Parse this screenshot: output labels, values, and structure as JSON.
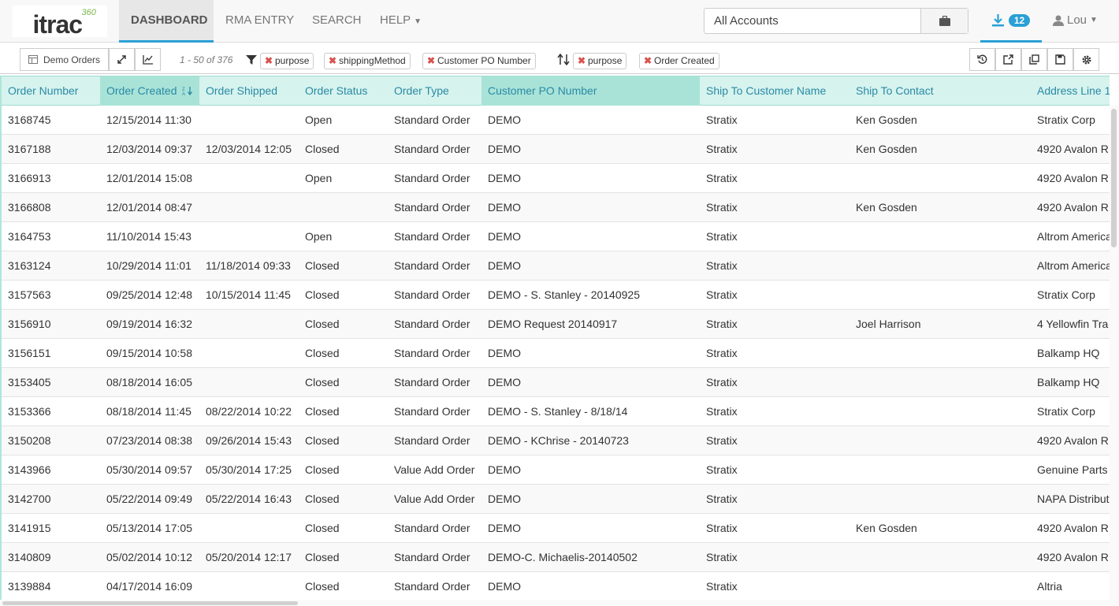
{
  "app": {
    "logo_text": "itrac",
    "logo_suffix": "360"
  },
  "nav": {
    "dashboard": "DASHBOARD",
    "rma": "RMA ENTRY",
    "search": "SEARCH",
    "help": "HELP"
  },
  "accounts": {
    "value": "All Accounts"
  },
  "downloads": {
    "count": "12"
  },
  "user": {
    "name": "Lou"
  },
  "toolbar": {
    "view_label": "Demo Orders",
    "count_text": "1 - 50 of 376",
    "filters": [
      "purpose",
      "shippingMethod",
      "Customer PO Number"
    ],
    "sorts": [
      "purpose",
      "Order Created"
    ]
  },
  "table": {
    "columns": [
      "Order Number",
      "Order Created",
      "Order Shipped",
      "Order Status",
      "Order Type",
      "Customer PO Number",
      "Ship To Customer Name",
      "Ship To Contact",
      "Address Line 1"
    ],
    "rows": [
      [
        "3168745",
        "12/15/2014 11:30",
        "",
        "Open",
        "Standard Order",
        "DEMO",
        "Stratix",
        "Ken Gosden",
        "Stratix Corp"
      ],
      [
        "3167188",
        "12/03/2014 09:37",
        "12/03/2014 12:05",
        "Closed",
        "Standard Order",
        "DEMO",
        "Stratix",
        "Ken Gosden",
        "4920 Avalon R"
      ],
      [
        "3166913",
        "12/01/2014 15:08",
        "",
        "Open",
        "Standard Order",
        "DEMO",
        "Stratix",
        "",
        "4920 Avalon R"
      ],
      [
        "3166808",
        "12/01/2014 08:47",
        "",
        "",
        "Standard Order",
        "DEMO",
        "Stratix",
        "Ken Gosden",
        "4920 Avalon R"
      ],
      [
        "3164753",
        "11/10/2014 15:43",
        "",
        "Open",
        "Standard Order",
        "DEMO",
        "Stratix",
        "",
        "Altrom America"
      ],
      [
        "3163124",
        "10/29/2014 11:01",
        "11/18/2014 09:33",
        "Closed",
        "Standard Order",
        "DEMO",
        "Stratix",
        "",
        "Altrom America"
      ],
      [
        "3157563",
        "09/25/2014 12:48",
        "10/15/2014 11:45",
        "Closed",
        "Standard Order",
        "DEMO - S. Stanley - 20140925",
        "Stratix",
        "",
        "Stratix Corp"
      ],
      [
        "3156910",
        "09/19/2014 16:32",
        "",
        "Closed",
        "Standard Order",
        "DEMO Request 20140917",
        "Stratix",
        "Joel Harrison",
        "4 Yellowfin Tra"
      ],
      [
        "3156151",
        "09/15/2014 10:58",
        "",
        "Closed",
        "Standard Order",
        "DEMO",
        "Stratix",
        "",
        "Balkamp HQ"
      ],
      [
        "3153405",
        "08/18/2014 16:05",
        "",
        "Closed",
        "Standard Order",
        "DEMO",
        "Stratix",
        "",
        "Balkamp HQ"
      ],
      [
        "3153366",
        "08/18/2014 11:45",
        "08/22/2014 10:22",
        "Closed",
        "Standard Order",
        "DEMO - S. Stanley - 8/18/14",
        "Stratix",
        "",
        "Stratix Corp"
      ],
      [
        "3150208",
        "07/23/2014 08:38",
        "09/26/2014 15:43",
        "Closed",
        "Standard Order",
        "DEMO - KChrise - 20140723",
        "Stratix",
        "",
        "4920 Avalon R"
      ],
      [
        "3143966",
        "05/30/2014 09:57",
        "05/30/2014 17:25",
        "Closed",
        "Value Add Order",
        "DEMO",
        "Stratix",
        "",
        "Genuine Parts"
      ],
      [
        "3142700",
        "05/22/2014 09:49",
        "05/22/2014 16:43",
        "Closed",
        "Value Add Order",
        "DEMO",
        "Stratix",
        "",
        "NAPA Distribut"
      ],
      [
        "3141915",
        "05/13/2014 17:05",
        "",
        "Closed",
        "Standard Order",
        "DEMO",
        "Stratix",
        "Ken Gosden",
        "4920 Avalon R"
      ],
      [
        "3140809",
        "05/02/2014 10:12",
        "05/20/2014 12:17",
        "Closed",
        "Standard Order",
        "DEMO-C. Michaelis-20140502",
        "Stratix",
        "",
        "4920 Avalon R"
      ],
      [
        "3139884",
        "04/17/2014 16:09",
        "",
        "Closed",
        "Standard Order",
        "DEMO",
        "Stratix",
        "",
        "Altria"
      ]
    ]
  }
}
